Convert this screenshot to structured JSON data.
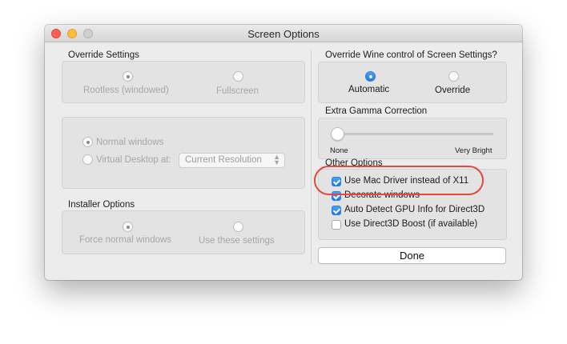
{
  "window": {
    "title": "Screen Options"
  },
  "override_settings": {
    "heading": "Override Settings",
    "options": [
      "Rootless (windowed)",
      "Fullscreen"
    ],
    "selected": "Rootless (windowed)"
  },
  "windows_mode": {
    "options": [
      "Normal windows",
      "Virtual Desktop at:"
    ],
    "selected": "Normal windows",
    "resolution_value": "Current Resolution"
  },
  "installer_options": {
    "heading": "Installer Options",
    "options": [
      "Force normal windows",
      "Use these settings"
    ],
    "selected": "Force normal windows"
  },
  "wine_control": {
    "heading": "Override Wine control of Screen Settings?",
    "options": [
      "Automatic",
      "Override"
    ],
    "selected": "Automatic"
  },
  "gamma": {
    "heading": "Extra Gamma Correction",
    "min_label": "None",
    "max_label": "Very Bright",
    "value_fraction": 0.0
  },
  "other_options": {
    "heading": "Other Options",
    "items": [
      {
        "label": "Use Mac Driver instead of X11",
        "checked": true
      },
      {
        "label": "Decorate windows",
        "checked": true
      },
      {
        "label": "Auto Detect GPU Info for Direct3D",
        "checked": true
      },
      {
        "label": "Use Direct3D Boost (if available)",
        "checked": false
      }
    ]
  },
  "done_label": "Done",
  "colors": {
    "accent_blue": "#1a79ee",
    "highlight_red": "#e6473c",
    "close_red": "#fc605b",
    "minimize_yellow": "#fdbc40"
  }
}
